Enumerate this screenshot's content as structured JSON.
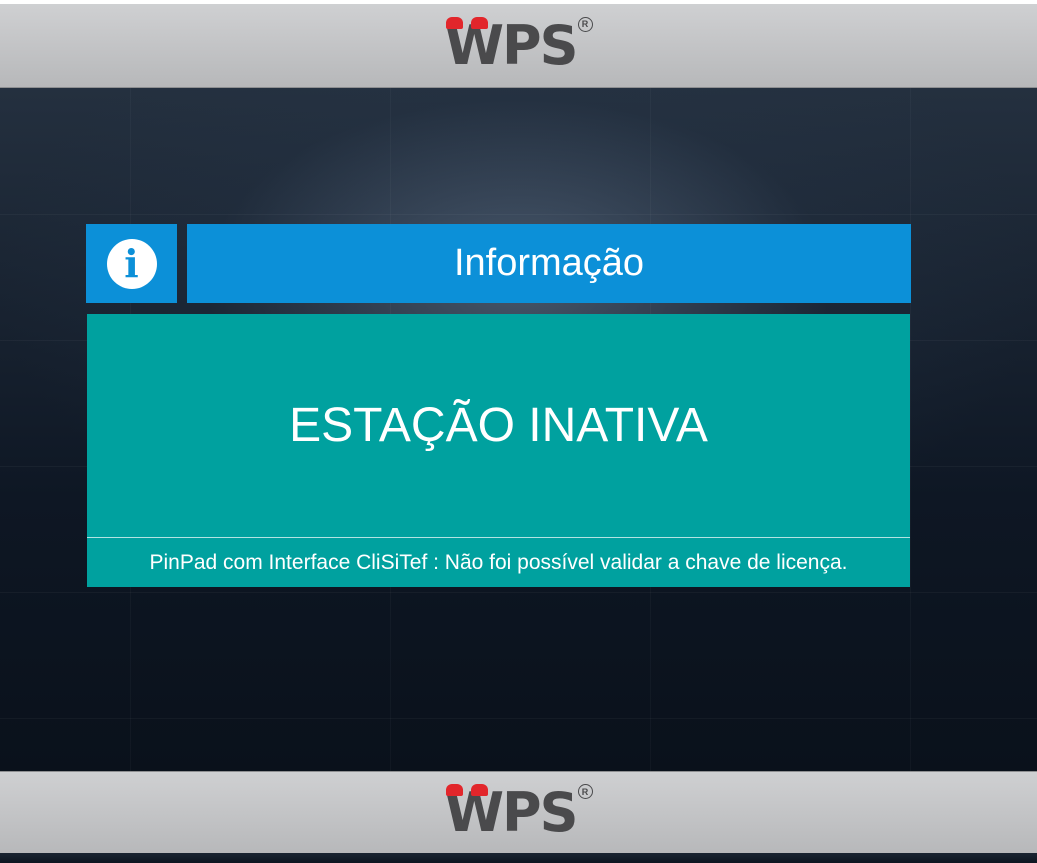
{
  "header": {
    "logo_text": "WPS",
    "logo_mark": "R"
  },
  "dialog": {
    "icon": "info-icon",
    "icon_glyph": "i",
    "title": "Informação",
    "message": "ESTAÇÃO INATIVA",
    "detail": "PinPad com Interface CliSiTef : Não foi possível validar a chave de licença."
  },
  "footer": {
    "logo_text": "WPS",
    "logo_mark": "R"
  },
  "colors": {
    "title_blue": "#0c90d8",
    "message_teal": "#00a19f",
    "logo_red": "#e2262b",
    "logo_gray": "#4a4a4c",
    "bar_gray": "#c4c5c7"
  }
}
